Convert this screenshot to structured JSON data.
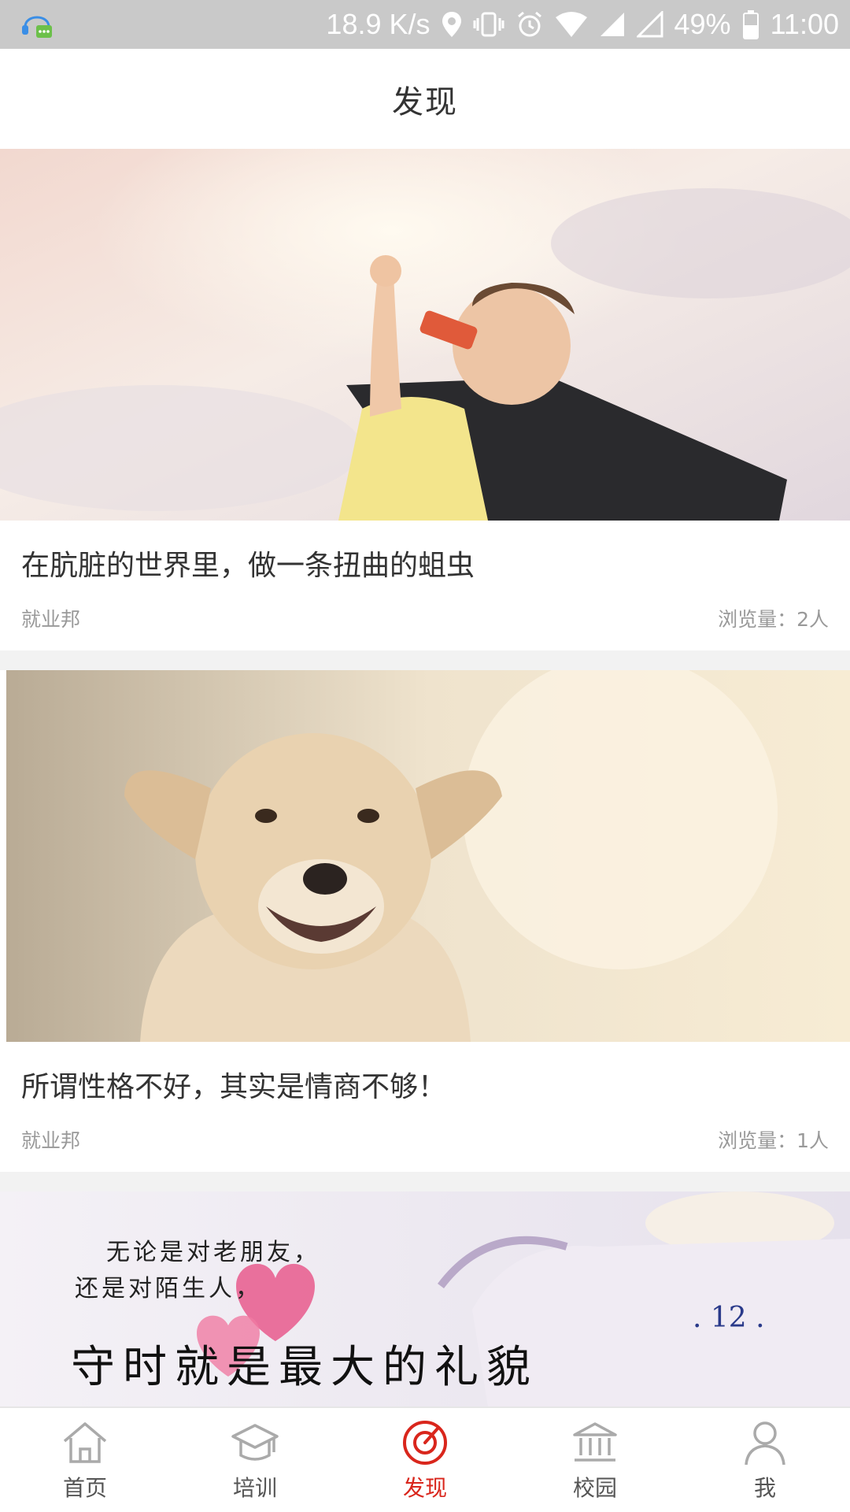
{
  "status_bar": {
    "network_speed": "18.9 K/s",
    "battery": "49%",
    "time": "11:00"
  },
  "header": {
    "title": "发现"
  },
  "articles": [
    {
      "title": "在肮脏的世界里，做一条扭曲的蛆虫",
      "source": "就业邦",
      "views": "浏览量：2人"
    },
    {
      "title": "所谓性格不好，其实是情商不够！",
      "source": "就业邦",
      "views": "浏览量：1人"
    },
    {
      "image_text": {
        "line1": "无论是对老朋友，",
        "line2": "还是对陌生人，",
        "line3": "守时就是最大的礼貌",
        "clock": ". 12 ."
      }
    }
  ],
  "tabbar": {
    "tabs": [
      {
        "label": "首页",
        "icon": "home-icon"
      },
      {
        "label": "培训",
        "icon": "graduation-cap-icon"
      },
      {
        "label": "发现",
        "icon": "discover-icon",
        "active": true
      },
      {
        "label": "校园",
        "icon": "campus-building-icon"
      },
      {
        "label": "我",
        "icon": "user-icon"
      }
    ],
    "active_color": "#d9261c",
    "inactive_color": "#999999"
  }
}
